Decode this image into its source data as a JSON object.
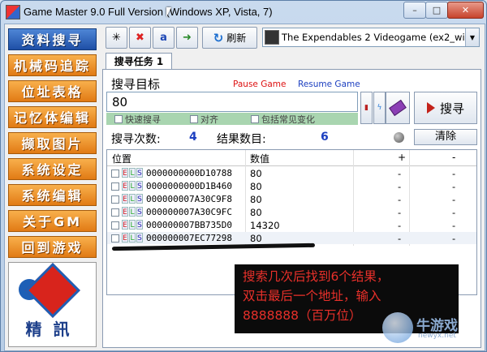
{
  "window": {
    "title": "Game Master 9.0 Full Version (Windows XP, Vista, 7)",
    "min": "–",
    "max": "□",
    "close": "✕"
  },
  "sidebar": {
    "items": [
      {
        "label": "资料搜寻"
      },
      {
        "label": "机械码追踪"
      },
      {
        "label": "位址表格"
      },
      {
        "label": "记忆体编辑"
      },
      {
        "label": "撷取图片"
      },
      {
        "label": "系统设定"
      },
      {
        "label": "系统编辑"
      },
      {
        "label": "关于GM"
      },
      {
        "label": "回到游戏"
      }
    ],
    "logo_text": "精訊"
  },
  "toolbar": {
    "refresh_label": "刷新",
    "process": "The Expendables 2 Videogame (ex2_win):3524/0"
  },
  "tab": {
    "label": "搜寻任务 1"
  },
  "search": {
    "target_label": "搜寻目标",
    "pause_label": "Pause Game",
    "resume_label": "Resume Game",
    "value": "80",
    "search_button": "搜寻",
    "options": [
      "快速搜寻",
      "对齐",
      "包括常见变化"
    ]
  },
  "stats": {
    "count_label": "搜寻次数:",
    "count_value": "4",
    "result_label": "结果数目:",
    "result_value": "6",
    "clear_label": "清除"
  },
  "table": {
    "headers": {
      "address": "位置",
      "value": "数值",
      "plus": "+",
      "minus": "-"
    },
    "rows": [
      {
        "address": "0000000000D10788",
        "value": "80",
        "plus": "-",
        "minus": "-"
      },
      {
        "address": "0000000000D1B460",
        "value": "80",
        "plus": "-",
        "minus": "-"
      },
      {
        "address": "000000007A30C9F8",
        "value": "80",
        "plus": "-",
        "minus": "-"
      },
      {
        "address": "000000007A30C9FC",
        "value": "80",
        "plus": "-",
        "minus": "-"
      },
      {
        "address": "000000007BB735D0",
        "value": "14320",
        "plus": "-",
        "minus": "-"
      },
      {
        "address": "000000007EC77298",
        "value": "80",
        "plus": "-",
        "minus": "-"
      }
    ]
  },
  "annotation": {
    "line1": "搜索几次后找到6个结果，",
    "line2": "双击最后一个地址，输入",
    "line3": "8888888（百万位）"
  },
  "watermark": {
    "name": "牛游戏",
    "url": "newyx.net"
  }
}
